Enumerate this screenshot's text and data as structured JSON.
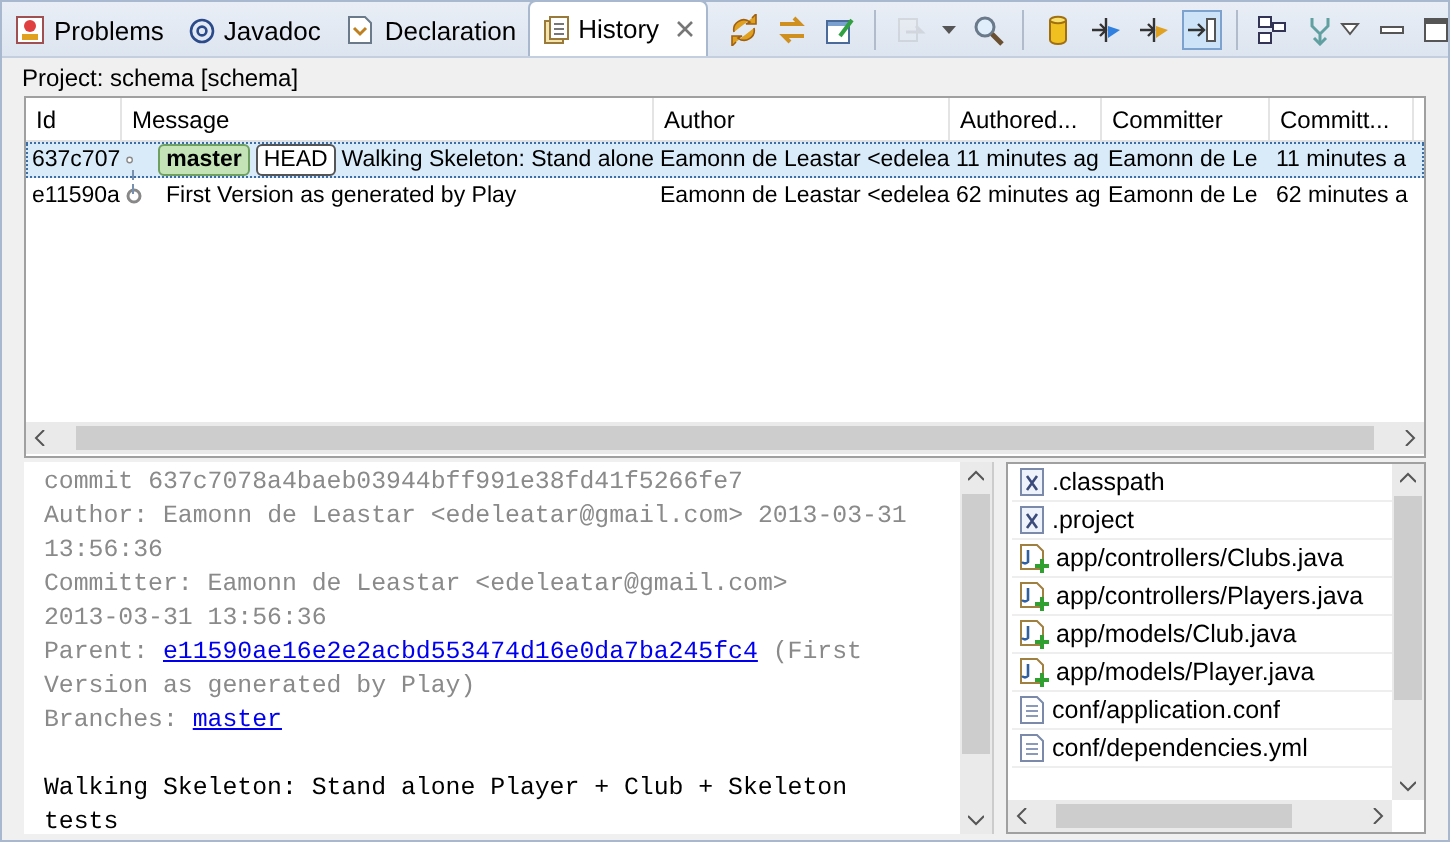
{
  "tabs": [
    {
      "label": "Problems",
      "selected": false
    },
    {
      "label": "Javadoc",
      "selected": false
    },
    {
      "label": "Declaration",
      "selected": false
    },
    {
      "label": "History",
      "selected": true
    }
  ],
  "toolbar": [
    {
      "kind": "sync",
      "on": false
    },
    {
      "kind": "compare",
      "on": false
    },
    {
      "kind": "link",
      "on": false
    },
    {
      "kind": "sep"
    },
    {
      "kind": "filter",
      "on": false,
      "disabled": true
    },
    {
      "kind": "dropdown",
      "on": false
    },
    {
      "kind": "search",
      "on": false
    },
    {
      "kind": "sep"
    },
    {
      "kind": "cylinder",
      "on": false
    },
    {
      "kind": "branch",
      "on": false
    },
    {
      "kind": "branch-all",
      "on": false
    },
    {
      "kind": "files",
      "on": true
    },
    {
      "kind": "sep"
    },
    {
      "kind": "layout",
      "on": false
    },
    {
      "kind": "merge",
      "on": false
    }
  ],
  "project": "Project: schema [schema]",
  "table": {
    "columns": [
      "Id",
      "Message",
      "Author",
      "Authored...",
      "Committer",
      "Committ..."
    ],
    "rows": [
      {
        "id": "637c707",
        "refs": [
          {
            "name": "master",
            "kind": "branch"
          },
          {
            "name": "HEAD",
            "kind": "head"
          }
        ],
        "message": "Walking Skeleton: Stand alone",
        "author": "Eamonn de Leastar <edelea",
        "authored": "11 minutes ag",
        "committer": "Eamonn de Le",
        "committed": "11 minutes a",
        "selected": true
      },
      {
        "id": "e11590a",
        "refs": [],
        "message": "First Version as generated by Play",
        "author": "Eamonn de Leastar <edelea",
        "authored": "62 minutes ag",
        "committer": "Eamonn de Le",
        "committed": "62 minutes a",
        "selected": false
      }
    ]
  },
  "commit_info": [
    {
      "kind": "text",
      "text": "commit 637c7078a4baeb03944bff991e38fd41f5266fe7"
    },
    {
      "kind": "text",
      "text": "Author: Eamonn de Leastar <edeleatar@gmail.com> 2013-03-31 13:56:36"
    },
    {
      "kind": "text",
      "text": "Committer: Eamonn de Leastar <edeleatar@gmail.com> 2013-03-31 13:56:36"
    },
    {
      "kind": "link",
      "label": "Parent:",
      "link": "e11590ae16e2e2acbd553474d16e0da7ba245fc4",
      "suffix": "(First Version as generated by Play)"
    },
    {
      "kind": "link",
      "label": "Branches:",
      "link": "master"
    },
    {
      "kind": "message",
      "text": "Walking Skeleton: Stand alone Player + Club + Skeleton tests"
    }
  ],
  "files": [
    {
      "name": ".classpath",
      "kind": "xml"
    },
    {
      "name": ".project",
      "kind": "xml"
    },
    {
      "name": "app/controllers/Clubs.java",
      "kind": "java"
    },
    {
      "name": "app/controllers/Players.java",
      "kind": "java"
    },
    {
      "name": "app/models/Club.java",
      "kind": "java"
    },
    {
      "name": "app/models/Player.java",
      "kind": "java"
    },
    {
      "name": "conf/application.conf",
      "kind": "text"
    },
    {
      "name": "conf/dependencies.yml",
      "kind": "text"
    }
  ]
}
